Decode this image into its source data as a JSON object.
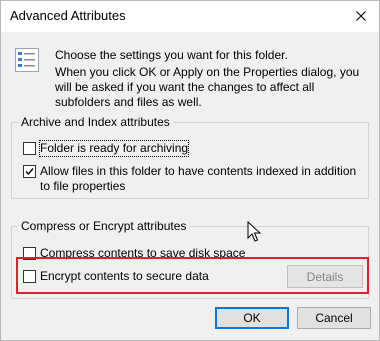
{
  "window": {
    "title": "Advanced Attributes",
    "close_glyph": "✕"
  },
  "header": {
    "icon": "attributes-list-icon",
    "line1": "Choose the settings you want for this folder.",
    "line2": "When you click OK or Apply on the Properties dialog, you will be asked if you want the changes to affect all subfolders and files as well."
  },
  "archive_group": {
    "legend": "Archive and Index attributes",
    "folder_archiving": {
      "label": "Folder is ready for archiving",
      "checked": false
    },
    "allow_indexing": {
      "label": "Allow files in this folder to have contents indexed in addition to file properties",
      "checked": true
    }
  },
  "compress_group": {
    "legend": "Compress or Encrypt attributes",
    "compress": {
      "label": "Compress contents to save disk space",
      "checked": false
    },
    "encrypt": {
      "label": "Encrypt contents to secure data",
      "checked": false
    },
    "details_label": "Details"
  },
  "buttons": {
    "ok_label": "OK",
    "cancel_label": "Cancel"
  },
  "colors": {
    "highlight": "#e0202a",
    "default_button_border": "#0078d7",
    "window_bg": "#f0f0f0"
  }
}
